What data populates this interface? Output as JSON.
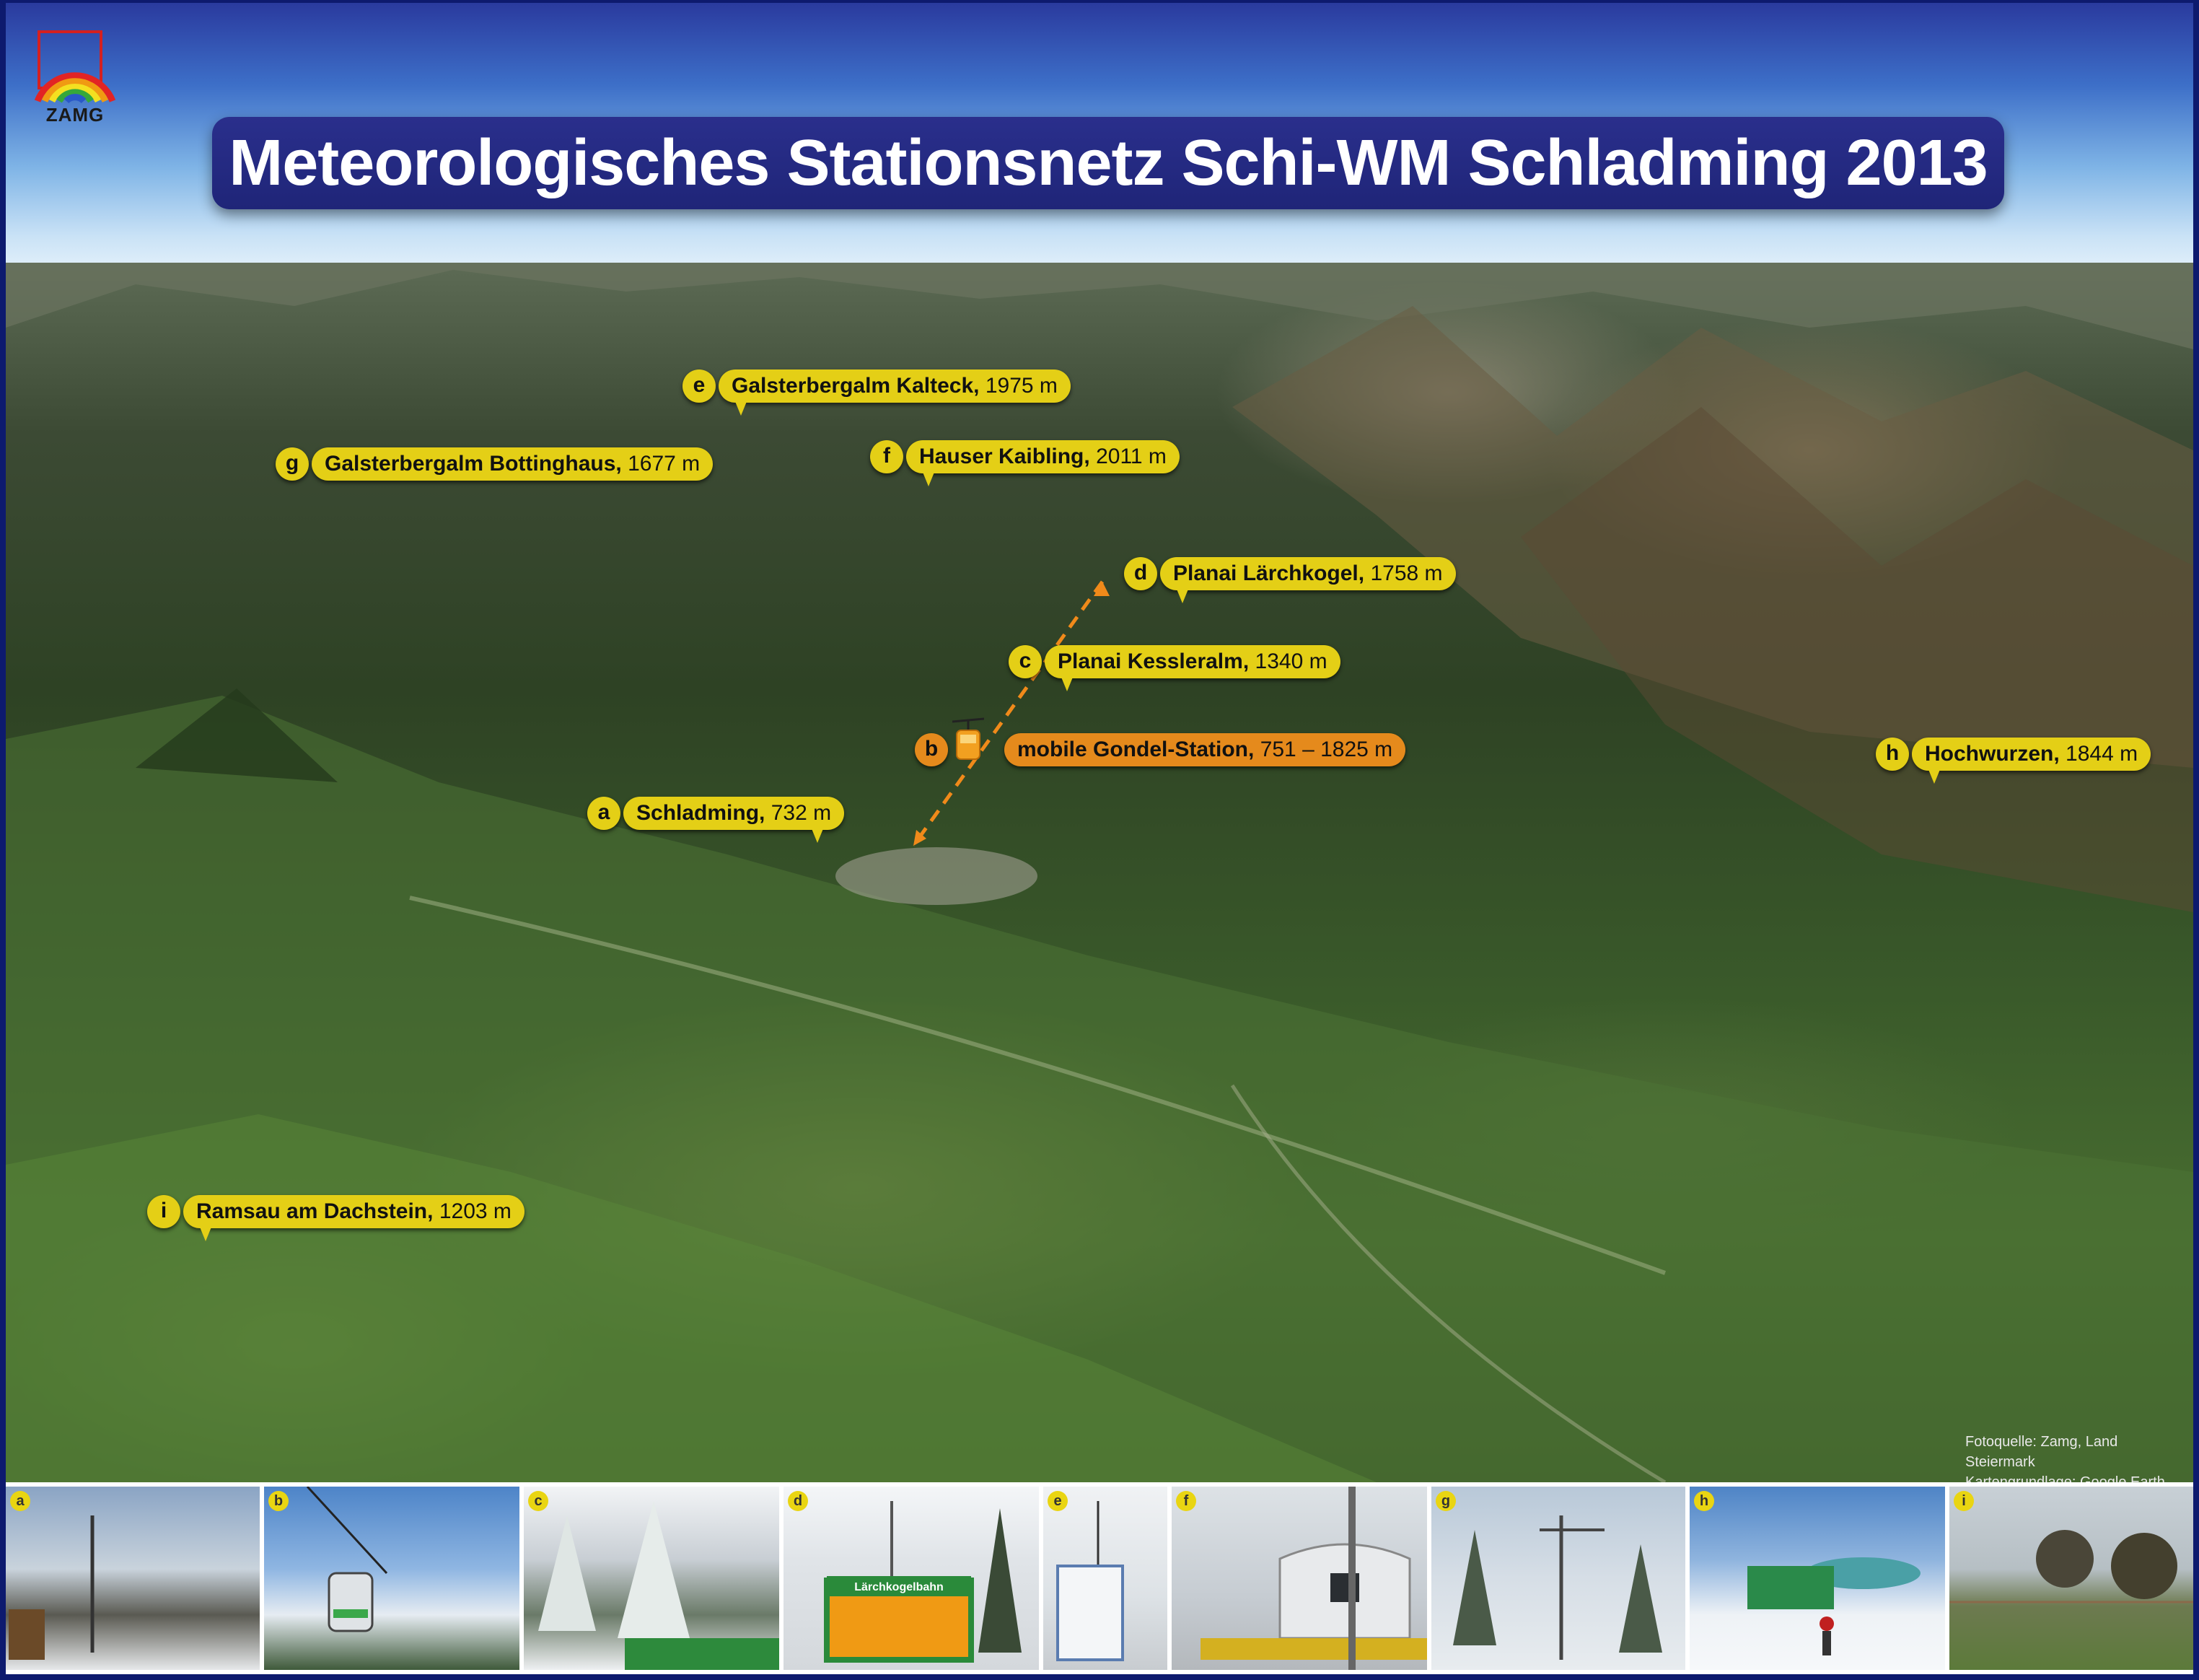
{
  "logo": {
    "text": "ZAMG"
  },
  "title": "Meteorologisches Stationsnetz Schi-WM Schladming 2013",
  "stations": [
    {
      "id": "e",
      "name": "Galsterbergalm Kalteck",
      "elevation": "1975 m"
    },
    {
      "id": "g",
      "name": "Galsterbergalm Bottinghaus",
      "elevation": "1677 m"
    },
    {
      "id": "f",
      "name": "Hauser Kaibling",
      "elevation": "2011 m"
    },
    {
      "id": "d",
      "name": "Planai Lärchkogel",
      "elevation": "1758 m"
    },
    {
      "id": "c",
      "name": "Planai Kessleralm",
      "elevation": "1340 m"
    },
    {
      "id": "b",
      "name": "mobile Gondel-Station",
      "elevation": "751 – 1825 m"
    },
    {
      "id": "a",
      "name": "Schladming",
      "elevation": "732 m"
    },
    {
      "id": "h",
      "name": "Hochwurzen",
      "elevation": "1844 m"
    },
    {
      "id": "i",
      "name": "Ramsau am Dachstein",
      "elevation": "1203 m"
    }
  ],
  "comma": ",",
  "colors": {
    "label": "#e4cf16",
    "mobile_label": "#e58a1c",
    "banner": "#23297e"
  },
  "photos": [
    {
      "letter": "a",
      "caption_icon": "weather-mast-photo"
    },
    {
      "letter": "b",
      "caption_icon": "gondola-photo"
    },
    {
      "letter": "c",
      "caption_icon": "snowy-forest-photo"
    },
    {
      "letter": "d",
      "caption_icon": "station-hut-photo",
      "sign": "Lärchkogelbahn"
    },
    {
      "letter": "e",
      "caption_icon": "container-station-photo"
    },
    {
      "letter": "f",
      "caption_icon": "summit-station-photo"
    },
    {
      "letter": "g",
      "caption_icon": "met-mast-photo"
    },
    {
      "letter": "h",
      "caption_icon": "lift-station-photo"
    },
    {
      "letter": "i",
      "caption_icon": "meadow-station-photo"
    }
  ],
  "credits": {
    "photo_source": "Fotoquelle: Zamg, Land Steiermark",
    "map_source": "Kartengrundlage: Google Earth"
  }
}
